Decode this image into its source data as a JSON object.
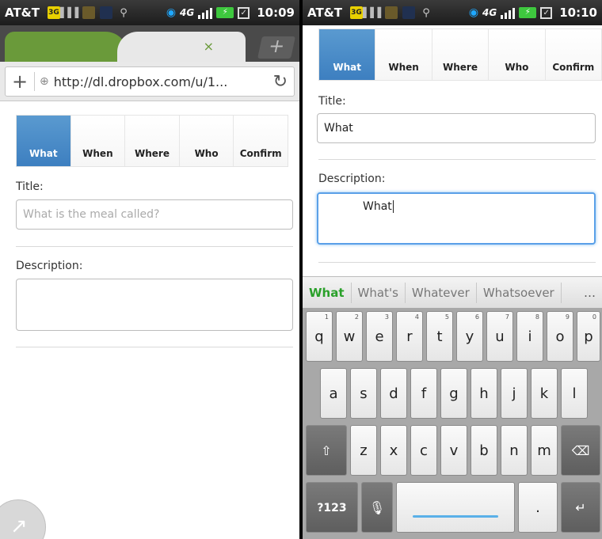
{
  "left": {
    "status": {
      "carrier": "AT&T",
      "time": "10:09",
      "net": "4G"
    },
    "url": "http://dl.dropbox.com/u/1...",
    "steps": [
      "What",
      "When",
      "Where",
      "Who",
      "Confirm"
    ],
    "title_label": "Title:",
    "title_placeholder": "What is the meal called?",
    "description_label": "Description:"
  },
  "right": {
    "status": {
      "carrier": "AT&T",
      "time": "10:10",
      "net": "4G"
    },
    "steps": [
      "What",
      "When",
      "Where",
      "Who",
      "Confirm"
    ],
    "title_label": "Title:",
    "title_value": "What",
    "description_label": "Description:",
    "description_value": "What",
    "suggestions": [
      "What",
      "What's",
      "Whatever",
      "Whatsoever",
      "…"
    ],
    "keyboard": {
      "row1": [
        "q",
        "w",
        "e",
        "r",
        "t",
        "y",
        "u",
        "i",
        "o",
        "p"
      ],
      "row1_nums": [
        "1",
        "2",
        "3",
        "4",
        "5",
        "6",
        "7",
        "8",
        "9",
        "0"
      ],
      "row2": [
        "a",
        "s",
        "d",
        "f",
        "g",
        "h",
        "j",
        "k",
        "l"
      ],
      "row3": [
        "z",
        "x",
        "c",
        "v",
        "b",
        "n",
        "m"
      ],
      "symbols_label": "?123",
      "period": "."
    }
  },
  "icons": {
    "tab_close": "×",
    "tab_new": "+",
    "url_add": "+",
    "globe": "⊕",
    "reload": "↻",
    "shift": "⇧",
    "delete": "⌫",
    "mic": "🎙",
    "enter": "↵",
    "share": "↗"
  },
  "colors": {
    "step_active": "#3d7fc0",
    "suggest_primary": "#2aa02a",
    "tab_green": "#6a9a3a"
  }
}
